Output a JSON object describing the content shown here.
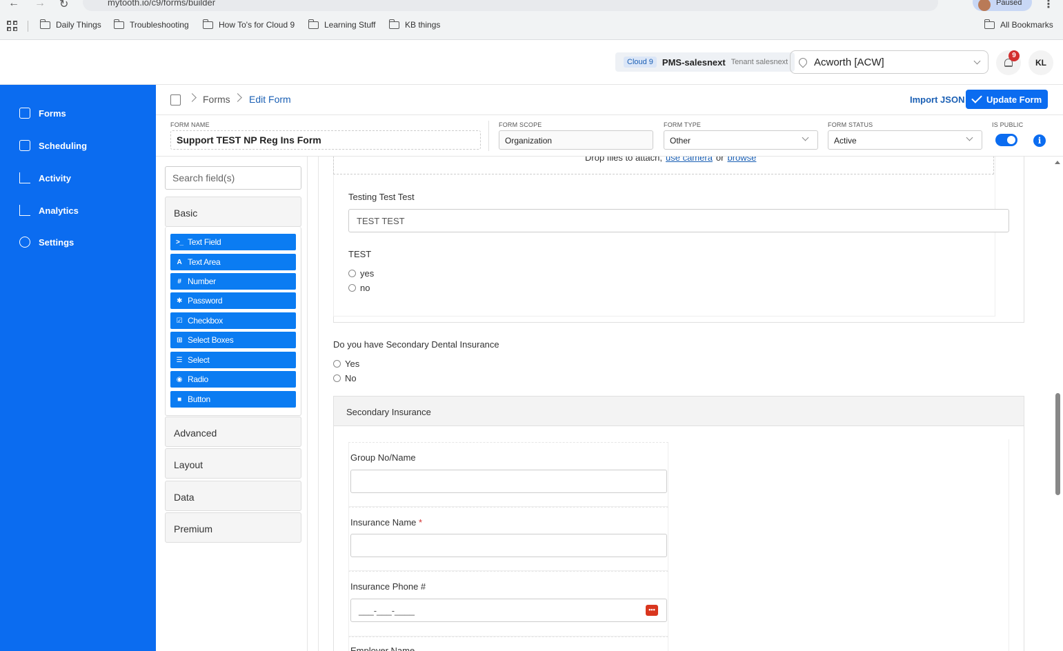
{
  "browser": {
    "url": "mytooth.io/c9/forms/builder",
    "paused_label": "Paused",
    "bookmarks": [
      "Daily Things",
      "Troubleshooting",
      "How To's for Cloud 9",
      "Learning Stuff",
      "KB things"
    ],
    "all_bookmarks": "All Bookmarks"
  },
  "header": {
    "tenant_badge": "Cloud 9",
    "tenant_name": "PMS-salesnext",
    "tenant_sub": "Tenant salesnext",
    "location": "Acworth [ACW]",
    "notifications": "9",
    "user_initials": "KL"
  },
  "sidebar": {
    "items": [
      {
        "label": "Forms",
        "icon": "forms-icon"
      },
      {
        "label": "Scheduling",
        "icon": "calendar-icon"
      },
      {
        "label": "Activity",
        "icon": "activity-icon"
      },
      {
        "label": "Analytics",
        "icon": "analytics-icon"
      },
      {
        "label": "Settings",
        "icon": "gear-icon"
      }
    ]
  },
  "breadcrumb": {
    "forms": "Forms",
    "edit": "Edit Form"
  },
  "toolbar": {
    "import_json": "Import JSON",
    "update_form": "Update Form"
  },
  "settings": {
    "form_name_label": "FORM NAME",
    "form_name": "Support TEST NP Reg Ins Form",
    "form_scope_label": "FORM SCOPE",
    "form_scope": "Organization",
    "form_type_label": "FORM TYPE",
    "form_type": "Other",
    "form_status_label": "FORM STATUS",
    "form_status": "Active",
    "is_public_label": "IS PUBLIC",
    "is_public": true
  },
  "palette": {
    "search_placeholder": "Search field(s)",
    "groups": {
      "basic": "Basic",
      "advanced": "Advanced",
      "layout": "Layout",
      "data": "Data",
      "premium": "Premium"
    },
    "components": [
      {
        "label": "Text Field",
        "icon": ">_"
      },
      {
        "label": "Text Area",
        "icon": "A"
      },
      {
        "label": "Number",
        "icon": "#"
      },
      {
        "label": "Password",
        "icon": "✱"
      },
      {
        "label": "Checkbox",
        "icon": "☑"
      },
      {
        "label": "Select Boxes",
        "icon": "⊞"
      },
      {
        "label": "Select",
        "icon": "☰"
      },
      {
        "label": "Radio",
        "icon": "◉"
      },
      {
        "label": "Button",
        "icon": "■"
      }
    ]
  },
  "canvas": {
    "drop_text": "Drop files to attach,",
    "use_camera": "use camera",
    "or": "or",
    "browse": "browse",
    "testing_label": "Testing Test Test",
    "testing_value": "TEST TEST",
    "test_radio_label": "TEST",
    "test_radio_options": [
      "yes",
      "no"
    ],
    "secondary_question": "Do you have Secondary Dental Insurance",
    "secondary_options": [
      "Yes",
      "No"
    ],
    "secondary_panel_title": "Secondary Insurance",
    "group_label": "Group No/Name",
    "insurance_name_label": "Insurance Name",
    "required_mark": "*",
    "insurance_phone_label": "Insurance Phone #",
    "phone_mask": "___-___-____",
    "employer_label": "Employer Name"
  }
}
